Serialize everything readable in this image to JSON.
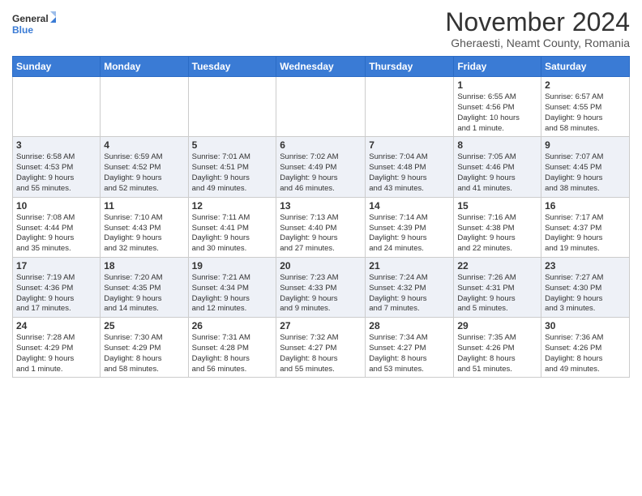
{
  "header": {
    "logo_line1": "General",
    "logo_line2": "Blue",
    "month_title": "November 2024",
    "location": "Gheraesti, Neamt County, Romania"
  },
  "calendar": {
    "days_of_week": [
      "Sunday",
      "Monday",
      "Tuesday",
      "Wednesday",
      "Thursday",
      "Friday",
      "Saturday"
    ],
    "weeks": [
      [
        {
          "day": "",
          "info": ""
        },
        {
          "day": "",
          "info": ""
        },
        {
          "day": "",
          "info": ""
        },
        {
          "day": "",
          "info": ""
        },
        {
          "day": "",
          "info": ""
        },
        {
          "day": "1",
          "info": "Sunrise: 6:55 AM\nSunset: 4:56 PM\nDaylight: 10 hours\nand 1 minute."
        },
        {
          "day": "2",
          "info": "Sunrise: 6:57 AM\nSunset: 4:55 PM\nDaylight: 9 hours\nand 58 minutes."
        }
      ],
      [
        {
          "day": "3",
          "info": "Sunrise: 6:58 AM\nSunset: 4:53 PM\nDaylight: 9 hours\nand 55 minutes."
        },
        {
          "day": "4",
          "info": "Sunrise: 6:59 AM\nSunset: 4:52 PM\nDaylight: 9 hours\nand 52 minutes."
        },
        {
          "day": "5",
          "info": "Sunrise: 7:01 AM\nSunset: 4:51 PM\nDaylight: 9 hours\nand 49 minutes."
        },
        {
          "day": "6",
          "info": "Sunrise: 7:02 AM\nSunset: 4:49 PM\nDaylight: 9 hours\nand 46 minutes."
        },
        {
          "day": "7",
          "info": "Sunrise: 7:04 AM\nSunset: 4:48 PM\nDaylight: 9 hours\nand 43 minutes."
        },
        {
          "day": "8",
          "info": "Sunrise: 7:05 AM\nSunset: 4:46 PM\nDaylight: 9 hours\nand 41 minutes."
        },
        {
          "day": "9",
          "info": "Sunrise: 7:07 AM\nSunset: 4:45 PM\nDaylight: 9 hours\nand 38 minutes."
        }
      ],
      [
        {
          "day": "10",
          "info": "Sunrise: 7:08 AM\nSunset: 4:44 PM\nDaylight: 9 hours\nand 35 minutes."
        },
        {
          "day": "11",
          "info": "Sunrise: 7:10 AM\nSunset: 4:43 PM\nDaylight: 9 hours\nand 32 minutes."
        },
        {
          "day": "12",
          "info": "Sunrise: 7:11 AM\nSunset: 4:41 PM\nDaylight: 9 hours\nand 30 minutes."
        },
        {
          "day": "13",
          "info": "Sunrise: 7:13 AM\nSunset: 4:40 PM\nDaylight: 9 hours\nand 27 minutes."
        },
        {
          "day": "14",
          "info": "Sunrise: 7:14 AM\nSunset: 4:39 PM\nDaylight: 9 hours\nand 24 minutes."
        },
        {
          "day": "15",
          "info": "Sunrise: 7:16 AM\nSunset: 4:38 PM\nDaylight: 9 hours\nand 22 minutes."
        },
        {
          "day": "16",
          "info": "Sunrise: 7:17 AM\nSunset: 4:37 PM\nDaylight: 9 hours\nand 19 minutes."
        }
      ],
      [
        {
          "day": "17",
          "info": "Sunrise: 7:19 AM\nSunset: 4:36 PM\nDaylight: 9 hours\nand 17 minutes."
        },
        {
          "day": "18",
          "info": "Sunrise: 7:20 AM\nSunset: 4:35 PM\nDaylight: 9 hours\nand 14 minutes."
        },
        {
          "day": "19",
          "info": "Sunrise: 7:21 AM\nSunset: 4:34 PM\nDaylight: 9 hours\nand 12 minutes."
        },
        {
          "day": "20",
          "info": "Sunrise: 7:23 AM\nSunset: 4:33 PM\nDaylight: 9 hours\nand 9 minutes."
        },
        {
          "day": "21",
          "info": "Sunrise: 7:24 AM\nSunset: 4:32 PM\nDaylight: 9 hours\nand 7 minutes."
        },
        {
          "day": "22",
          "info": "Sunrise: 7:26 AM\nSunset: 4:31 PM\nDaylight: 9 hours\nand 5 minutes."
        },
        {
          "day": "23",
          "info": "Sunrise: 7:27 AM\nSunset: 4:30 PM\nDaylight: 9 hours\nand 3 minutes."
        }
      ],
      [
        {
          "day": "24",
          "info": "Sunrise: 7:28 AM\nSunset: 4:29 PM\nDaylight: 9 hours\nand 1 minute."
        },
        {
          "day": "25",
          "info": "Sunrise: 7:30 AM\nSunset: 4:29 PM\nDaylight: 8 hours\nand 58 minutes."
        },
        {
          "day": "26",
          "info": "Sunrise: 7:31 AM\nSunset: 4:28 PM\nDaylight: 8 hours\nand 56 minutes."
        },
        {
          "day": "27",
          "info": "Sunrise: 7:32 AM\nSunset: 4:27 PM\nDaylight: 8 hours\nand 55 minutes."
        },
        {
          "day": "28",
          "info": "Sunrise: 7:34 AM\nSunset: 4:27 PM\nDaylight: 8 hours\nand 53 minutes."
        },
        {
          "day": "29",
          "info": "Sunrise: 7:35 AM\nSunset: 4:26 PM\nDaylight: 8 hours\nand 51 minutes."
        },
        {
          "day": "30",
          "info": "Sunrise: 7:36 AM\nSunset: 4:26 PM\nDaylight: 8 hours\nand 49 minutes."
        }
      ]
    ]
  }
}
